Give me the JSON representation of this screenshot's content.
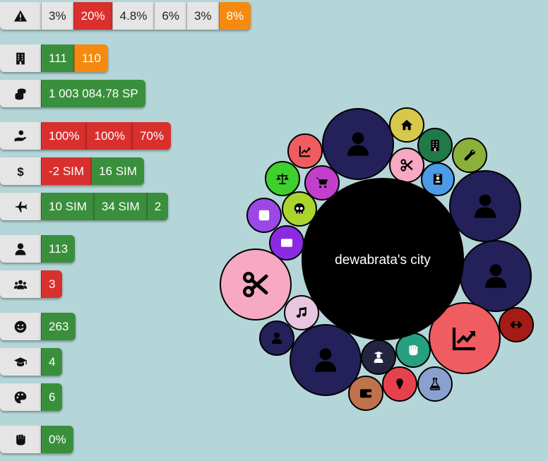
{
  "colors": {
    "background": "#b5d6d8",
    "green": "#3a8f3c",
    "red": "#d9302e",
    "orange": "#f68a10",
    "neutral": "#e5e5e5"
  },
  "stats": [
    {
      "icon": "warning-icon",
      "segments": [
        {
          "text": "3%",
          "color": "neutral"
        },
        {
          "text": "20%",
          "color": "red"
        },
        {
          "text": "4.8%",
          "color": "neutral"
        },
        {
          "text": "6%",
          "color": "neutral"
        },
        {
          "text": "3%",
          "color": "neutral"
        },
        {
          "text": "8%",
          "color": "orange"
        }
      ]
    },
    {
      "icon": "building-icon",
      "segments": [
        {
          "text": "111",
          "color": "green"
        },
        {
          "text": "110",
          "color": "orange"
        }
      ]
    },
    {
      "icon": "coins-icon",
      "segments": [
        {
          "text": "1 003 084.78 SP",
          "color": "green"
        }
      ]
    },
    {
      "icon": "hand-coin-icon",
      "segments": [
        {
          "text": "100%",
          "color": "red"
        },
        {
          "text": "100%",
          "color": "red"
        },
        {
          "text": "70%",
          "color": "red"
        }
      ]
    },
    {
      "icon": "dollar-icon",
      "segments": [
        {
          "text": "-2 SIM",
          "color": "red"
        },
        {
          "text": "16 SIM",
          "color": "green"
        }
      ]
    },
    {
      "icon": "plane-icon",
      "segments": [
        {
          "text": "10 SIM",
          "color": "green"
        },
        {
          "text": "34 SIM",
          "color": "green"
        },
        {
          "text": "2",
          "color": "green"
        }
      ]
    },
    {
      "icon": "person-icon",
      "segments": [
        {
          "text": "113",
          "color": "green"
        }
      ]
    },
    {
      "icon": "group-icon",
      "segments": [
        {
          "text": "3",
          "color": "red"
        }
      ]
    },
    {
      "icon": "smile-icon",
      "segments": [
        {
          "text": "263",
          "color": "green"
        }
      ]
    },
    {
      "icon": "graduation-cap-icon",
      "segments": [
        {
          "text": "4",
          "color": "green"
        }
      ]
    },
    {
      "icon": "palette-icon",
      "segments": [
        {
          "text": "6",
          "color": "green"
        }
      ]
    },
    {
      "icon": "fist-icon",
      "segments": [
        {
          "text": "0%",
          "color": "green"
        }
      ]
    }
  ],
  "city": {
    "name": "dewabrata's city",
    "bubbles": [
      {
        "icon": "person-icon",
        "color": "#23205a"
      },
      {
        "icon": "home-icon",
        "color": "#d7c84c"
      },
      {
        "icon": "building-icon",
        "color": "#1f7a47"
      },
      {
        "icon": "wrench-icon",
        "color": "#8ab23a"
      },
      {
        "icon": "scissors-icon",
        "color": "#f7a8c3"
      },
      {
        "icon": "id-card-icon",
        "color": "#4b9be8"
      },
      {
        "icon": "chart-icon",
        "color": "#ef5d60"
      },
      {
        "icon": "scales-icon",
        "color": "#3fcf2f"
      },
      {
        "icon": "cart-icon",
        "color": "#c23fcc"
      },
      {
        "icon": "skull-icon",
        "color": "#a9d52e"
      },
      {
        "icon": "parking-icon",
        "color": "#9b47e8"
      },
      {
        "icon": "ad-icon",
        "color": "#8a2be2"
      },
      {
        "icon": "person-icon",
        "color": "#23205a"
      },
      {
        "icon": "person-icon",
        "color": "#23205a"
      },
      {
        "icon": "scissors-icon",
        "color": "#f7a8c3"
      },
      {
        "icon": "music-icon",
        "color": "#e8c6e0"
      },
      {
        "icon": "chart-icon",
        "color": "#ef5d60"
      },
      {
        "icon": "dumbbell-icon",
        "color": "#a51c17"
      },
      {
        "icon": "person-icon",
        "color": "#23205a"
      },
      {
        "icon": "person-icon",
        "color": "#23205a"
      },
      {
        "icon": "teacher-icon",
        "color": "#23243f"
      },
      {
        "icon": "fist-icon",
        "color": "#26a07e"
      },
      {
        "icon": "icecream-icon",
        "color": "#e8414e"
      },
      {
        "icon": "flask-icon",
        "color": "#8aa1cf"
      },
      {
        "icon": "wallet-icon",
        "color": "#c0714d"
      }
    ]
  }
}
